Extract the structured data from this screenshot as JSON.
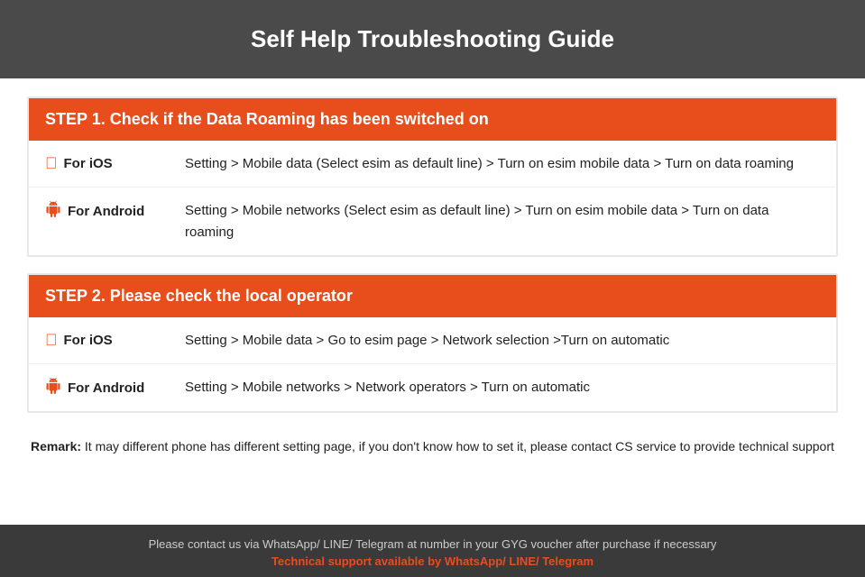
{
  "header": {
    "title": "Self Help Troubleshooting Guide"
  },
  "step1": {
    "heading": "STEP 1.  Check if the Data Roaming has been switched on",
    "ios_label": "For iOS",
    "ios_text": "Setting > Mobile data (Select esim as default line) > Turn on esim mobile data > Turn on data roaming",
    "android_label": "For Android",
    "android_text": "Setting > Mobile networks (Select esim as default line) > Turn on esim mobile data > Turn on data roaming"
  },
  "step2": {
    "heading": "STEP 2.  Please check the local operator",
    "ios_label": "For iOS",
    "ios_text": "Setting > Mobile data > Go to esim page > Network selection >Turn on automatic",
    "android_label": "For Android",
    "android_text": "Setting > Mobile networks > Network operators > Turn on automatic"
  },
  "remark": {
    "label": "Remark:",
    "text": " It may different phone has different setting page, if you don't know how to set it,  please contact CS service to provide technical support"
  },
  "footer": {
    "main_text": "Please contact us via WhatsApp/ LINE/ Telegram at number in your GYG voucher after purchase if necessary",
    "support_text": "Technical support available by WhatsApp/ LINE/ Telegram"
  }
}
